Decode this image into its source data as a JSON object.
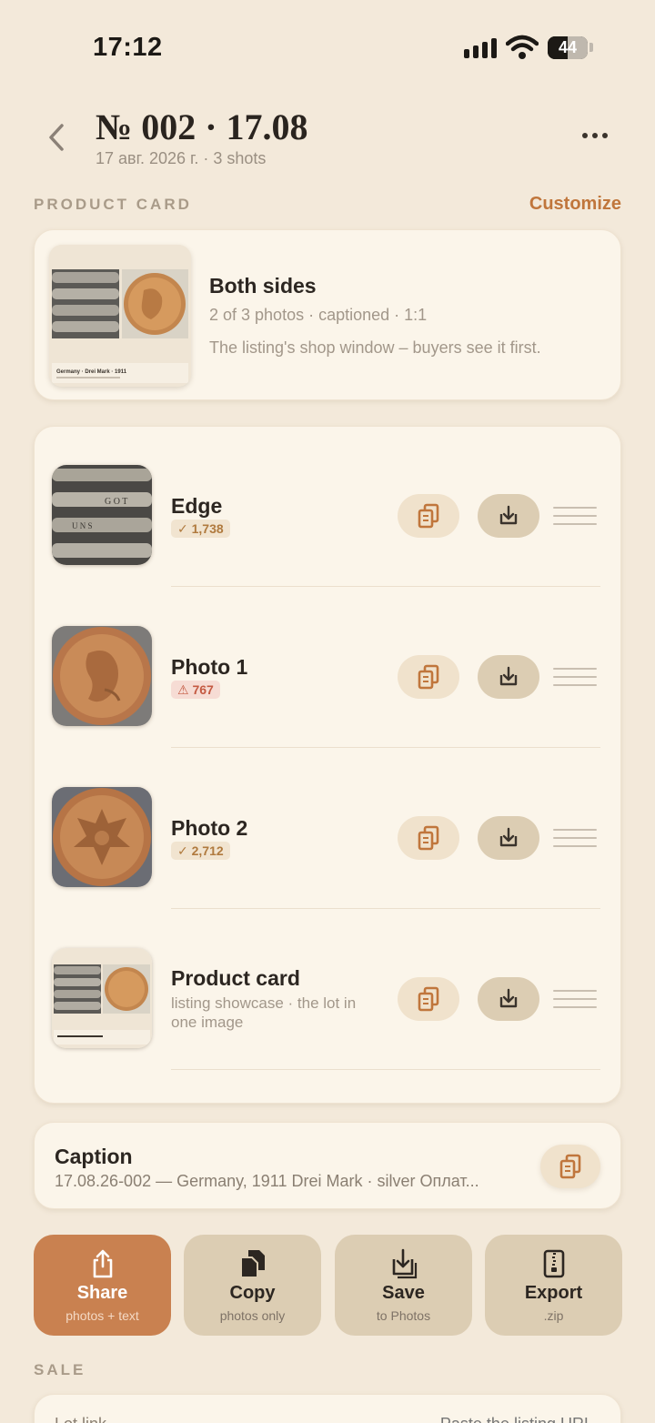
{
  "status_bar": {
    "time": "17:12",
    "battery": "44"
  },
  "header": {
    "title": "№ 002 · 17.08",
    "subtitle": "17 авг. 2026 г. · 3 shots"
  },
  "product_section": {
    "label": "PRODUCT CARD",
    "customize": "Customize"
  },
  "product_card": {
    "title": "Both sides",
    "meta": "2 of 3 photos · captioned · 1:1",
    "description": "The listing's shop window – buyers see it first.",
    "thumb_caption": "Germany · Drei Mark · 1911"
  },
  "photos": [
    {
      "title": "Edge",
      "badge": "✓ 1,738",
      "badge_type": "ok"
    },
    {
      "title": "Photo 1",
      "badge": "⚠ 767",
      "badge_type": "warn"
    },
    {
      "title": "Photo 2",
      "badge": "✓ 2,712",
      "badge_type": "ok"
    },
    {
      "title": "Product card",
      "subtitle": "listing showcase · the lot in one image"
    }
  ],
  "caption": {
    "title": "Caption",
    "text": "17.08.26-002 — Germany, 1911 Drei Mark · silver  Оплат..."
  },
  "actions": [
    {
      "label": "Share",
      "sub": "photos + text"
    },
    {
      "label": "Copy",
      "sub": "photos only"
    },
    {
      "label": "Save",
      "sub": "to Photos"
    },
    {
      "label": "Export",
      "sub": ".zip"
    }
  ],
  "sale_section": {
    "label": "SALE"
  },
  "sale": {
    "lot_link_label": "Lot link",
    "placeholder": "Paste the listing URL"
  },
  "colors": {
    "accent": "#c0763c",
    "background": "#f3e9da",
    "card": "#fbf5ea",
    "primary_button": "#c98150"
  }
}
